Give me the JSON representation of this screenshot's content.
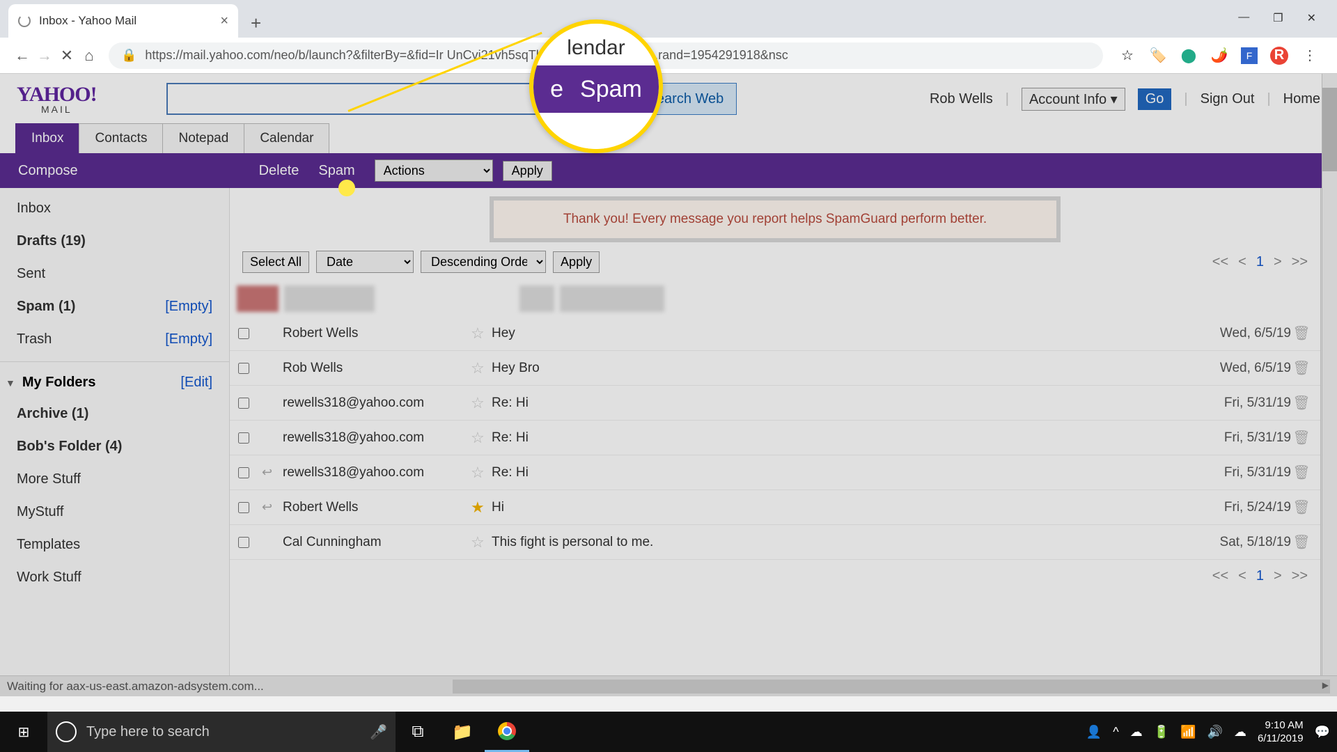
{
  "browser": {
    "tab_title": "Inbox - Yahoo Mail",
    "url": "https://mail.yahoo.com/neo/b/launch?&filterBy=&fid=Ir               UnCvi21vh5sqTkYYepW7ZxcAHd8-&.rand=1954291918&nsc",
    "avatar_letter": "R"
  },
  "header": {
    "logo_top": "YAHOO!",
    "logo_sub": "MAIL",
    "search_web": "Search Web",
    "user_name": "Rob Wells",
    "account_info": "Account Info ▾",
    "go": "Go",
    "sign_out": "Sign Out",
    "home": "Home"
  },
  "tabs": {
    "inbox": "Inbox",
    "contacts": "Contacts",
    "notepad": "Notepad",
    "calendar": "Calendar"
  },
  "actionbar": {
    "compose": "Compose",
    "delete": "Delete",
    "spam": "Spam",
    "actions": "Actions",
    "apply": "Apply"
  },
  "sidebar": {
    "inbox": "Inbox",
    "drafts": "Drafts (19)",
    "sent": "Sent",
    "spam": "Spam (1)",
    "spam_link": "[Empty]",
    "trash": "Trash",
    "trash_link": "[Empty]",
    "myfolders": "My Folders",
    "edit": "[Edit]",
    "archive": "Archive (1)",
    "bobs": "Bob's Folder (4)",
    "more": "More Stuff",
    "mystuff": "MyStuff",
    "templates": "Templates",
    "work": "Work Stuff"
  },
  "notice": "Thank you! Every message you report helps SpamGuard perform better.",
  "toolbar": {
    "select_all": "Select All",
    "sort1": "Date",
    "sort2": "Descending Order",
    "apply": "Apply",
    "page": "1",
    "first": "<<",
    "prev": "<",
    "next": ">",
    "last": ">>"
  },
  "emails": [
    {
      "sender": "Robert Wells",
      "subject": "Hey",
      "date": "Wed, 6/5/19",
      "reply": false,
      "star": false
    },
    {
      "sender": "Rob Wells",
      "subject": "Hey Bro",
      "date": "Wed, 6/5/19",
      "reply": false,
      "star": false
    },
    {
      "sender": "rewells318@yahoo.com",
      "subject": "Re: Hi",
      "date": "Fri, 5/31/19",
      "reply": false,
      "star": false
    },
    {
      "sender": "rewells318@yahoo.com",
      "subject": "Re: Hi",
      "date": "Fri, 5/31/19",
      "reply": false,
      "star": false
    },
    {
      "sender": "rewells318@yahoo.com",
      "subject": "Re: Hi",
      "date": "Fri, 5/31/19",
      "reply": true,
      "star": false
    },
    {
      "sender": "Robert Wells",
      "subject": "Hi",
      "date": "Fri, 5/24/19",
      "reply": true,
      "star": true
    },
    {
      "sender": "Cal Cunningham",
      "subject": "This fight is personal to me.",
      "date": "Sat, 5/18/19",
      "reply": false,
      "star": false
    }
  ],
  "magnifier": {
    "top_text": "lendar",
    "mid_left": "e",
    "mid_main": "Spam"
  },
  "status": "Waiting for aax-us-east.amazon-adsystem.com...",
  "taskbar": {
    "search_placeholder": "Type here to search",
    "time": "9:10 AM",
    "date": "6/11/2019"
  }
}
